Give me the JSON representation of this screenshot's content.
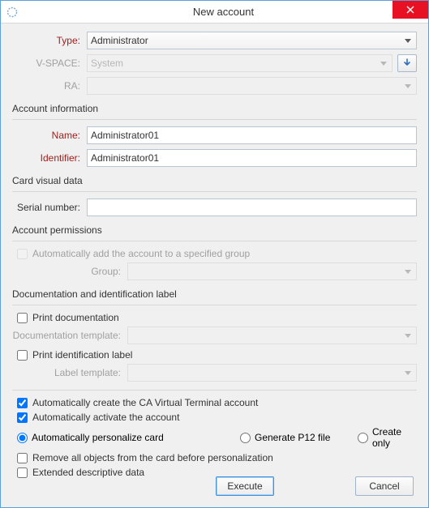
{
  "window": {
    "title": "New account"
  },
  "top": {
    "type_label": "Type:",
    "type_value": "Administrator",
    "vspace_label": "V-SPACE:",
    "vspace_value": "System",
    "ra_label": "RA:"
  },
  "sections": {
    "account_info": "Account information",
    "card_visual": "Card visual data",
    "permissions": "Account permissions",
    "doc": "Documentation and identification label"
  },
  "account": {
    "name_label": "Name:",
    "name_value": "Administrator01",
    "identifier_label": "Identifier:",
    "identifier_value": "Administrator01"
  },
  "card": {
    "serial_label": "Serial number:",
    "serial_value": ""
  },
  "perm": {
    "auto_group": "Automatically add the account to a specified group",
    "group_label": "Group:"
  },
  "doc": {
    "print_doc": "Print documentation",
    "doc_template_label": "Documentation template:",
    "print_id": "Print identification label",
    "label_template_label": "Label template:"
  },
  "opts": {
    "create_vt": "Automatically create the CA Virtual Terminal account",
    "activate": "Automatically activate the account",
    "personalize": "Automatically personalize card",
    "gen_p12": "Generate P12 file",
    "create_only": "Create only",
    "remove_objects": "Remove all objects from the card before personalization",
    "ext_desc": "Extended descriptive data"
  },
  "buttons": {
    "execute": "Execute",
    "cancel": "Cancel"
  }
}
